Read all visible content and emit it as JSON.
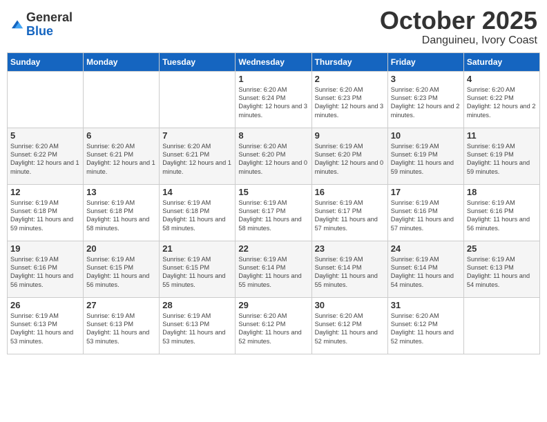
{
  "header": {
    "logo_general": "General",
    "logo_blue": "Blue",
    "month_title": "October 2025",
    "subtitle": "Danguineu, Ivory Coast"
  },
  "days_of_week": [
    "Sunday",
    "Monday",
    "Tuesday",
    "Wednesday",
    "Thursday",
    "Friday",
    "Saturday"
  ],
  "weeks": [
    [
      {
        "day": "",
        "text": ""
      },
      {
        "day": "",
        "text": ""
      },
      {
        "day": "",
        "text": ""
      },
      {
        "day": "1",
        "text": "Sunrise: 6:20 AM\nSunset: 6:24 PM\nDaylight: 12 hours and 3 minutes."
      },
      {
        "day": "2",
        "text": "Sunrise: 6:20 AM\nSunset: 6:23 PM\nDaylight: 12 hours and 3 minutes."
      },
      {
        "day": "3",
        "text": "Sunrise: 6:20 AM\nSunset: 6:23 PM\nDaylight: 12 hours and 2 minutes."
      },
      {
        "day": "4",
        "text": "Sunrise: 6:20 AM\nSunset: 6:22 PM\nDaylight: 12 hours and 2 minutes."
      }
    ],
    [
      {
        "day": "5",
        "text": "Sunrise: 6:20 AM\nSunset: 6:22 PM\nDaylight: 12 hours and 1 minute."
      },
      {
        "day": "6",
        "text": "Sunrise: 6:20 AM\nSunset: 6:21 PM\nDaylight: 12 hours and 1 minute."
      },
      {
        "day": "7",
        "text": "Sunrise: 6:20 AM\nSunset: 6:21 PM\nDaylight: 12 hours and 1 minute."
      },
      {
        "day": "8",
        "text": "Sunrise: 6:20 AM\nSunset: 6:20 PM\nDaylight: 12 hours and 0 minutes."
      },
      {
        "day": "9",
        "text": "Sunrise: 6:19 AM\nSunset: 6:20 PM\nDaylight: 12 hours and 0 minutes."
      },
      {
        "day": "10",
        "text": "Sunrise: 6:19 AM\nSunset: 6:19 PM\nDaylight: 11 hours and 59 minutes."
      },
      {
        "day": "11",
        "text": "Sunrise: 6:19 AM\nSunset: 6:19 PM\nDaylight: 11 hours and 59 minutes."
      }
    ],
    [
      {
        "day": "12",
        "text": "Sunrise: 6:19 AM\nSunset: 6:18 PM\nDaylight: 11 hours and 59 minutes."
      },
      {
        "day": "13",
        "text": "Sunrise: 6:19 AM\nSunset: 6:18 PM\nDaylight: 11 hours and 58 minutes."
      },
      {
        "day": "14",
        "text": "Sunrise: 6:19 AM\nSunset: 6:18 PM\nDaylight: 11 hours and 58 minutes."
      },
      {
        "day": "15",
        "text": "Sunrise: 6:19 AM\nSunset: 6:17 PM\nDaylight: 11 hours and 58 minutes."
      },
      {
        "day": "16",
        "text": "Sunrise: 6:19 AM\nSunset: 6:17 PM\nDaylight: 11 hours and 57 minutes."
      },
      {
        "day": "17",
        "text": "Sunrise: 6:19 AM\nSunset: 6:16 PM\nDaylight: 11 hours and 57 minutes."
      },
      {
        "day": "18",
        "text": "Sunrise: 6:19 AM\nSunset: 6:16 PM\nDaylight: 11 hours and 56 minutes."
      }
    ],
    [
      {
        "day": "19",
        "text": "Sunrise: 6:19 AM\nSunset: 6:16 PM\nDaylight: 11 hours and 56 minutes."
      },
      {
        "day": "20",
        "text": "Sunrise: 6:19 AM\nSunset: 6:15 PM\nDaylight: 11 hours and 56 minutes."
      },
      {
        "day": "21",
        "text": "Sunrise: 6:19 AM\nSunset: 6:15 PM\nDaylight: 11 hours and 55 minutes."
      },
      {
        "day": "22",
        "text": "Sunrise: 6:19 AM\nSunset: 6:14 PM\nDaylight: 11 hours and 55 minutes."
      },
      {
        "day": "23",
        "text": "Sunrise: 6:19 AM\nSunset: 6:14 PM\nDaylight: 11 hours and 55 minutes."
      },
      {
        "day": "24",
        "text": "Sunrise: 6:19 AM\nSunset: 6:14 PM\nDaylight: 11 hours and 54 minutes."
      },
      {
        "day": "25",
        "text": "Sunrise: 6:19 AM\nSunset: 6:13 PM\nDaylight: 11 hours and 54 minutes."
      }
    ],
    [
      {
        "day": "26",
        "text": "Sunrise: 6:19 AM\nSunset: 6:13 PM\nDaylight: 11 hours and 53 minutes."
      },
      {
        "day": "27",
        "text": "Sunrise: 6:19 AM\nSunset: 6:13 PM\nDaylight: 11 hours and 53 minutes."
      },
      {
        "day": "28",
        "text": "Sunrise: 6:19 AM\nSunset: 6:13 PM\nDaylight: 11 hours and 53 minutes."
      },
      {
        "day": "29",
        "text": "Sunrise: 6:20 AM\nSunset: 6:12 PM\nDaylight: 11 hours and 52 minutes."
      },
      {
        "day": "30",
        "text": "Sunrise: 6:20 AM\nSunset: 6:12 PM\nDaylight: 11 hours and 52 minutes."
      },
      {
        "day": "31",
        "text": "Sunrise: 6:20 AM\nSunset: 6:12 PM\nDaylight: 11 hours and 52 minutes."
      },
      {
        "day": "",
        "text": ""
      }
    ]
  ]
}
